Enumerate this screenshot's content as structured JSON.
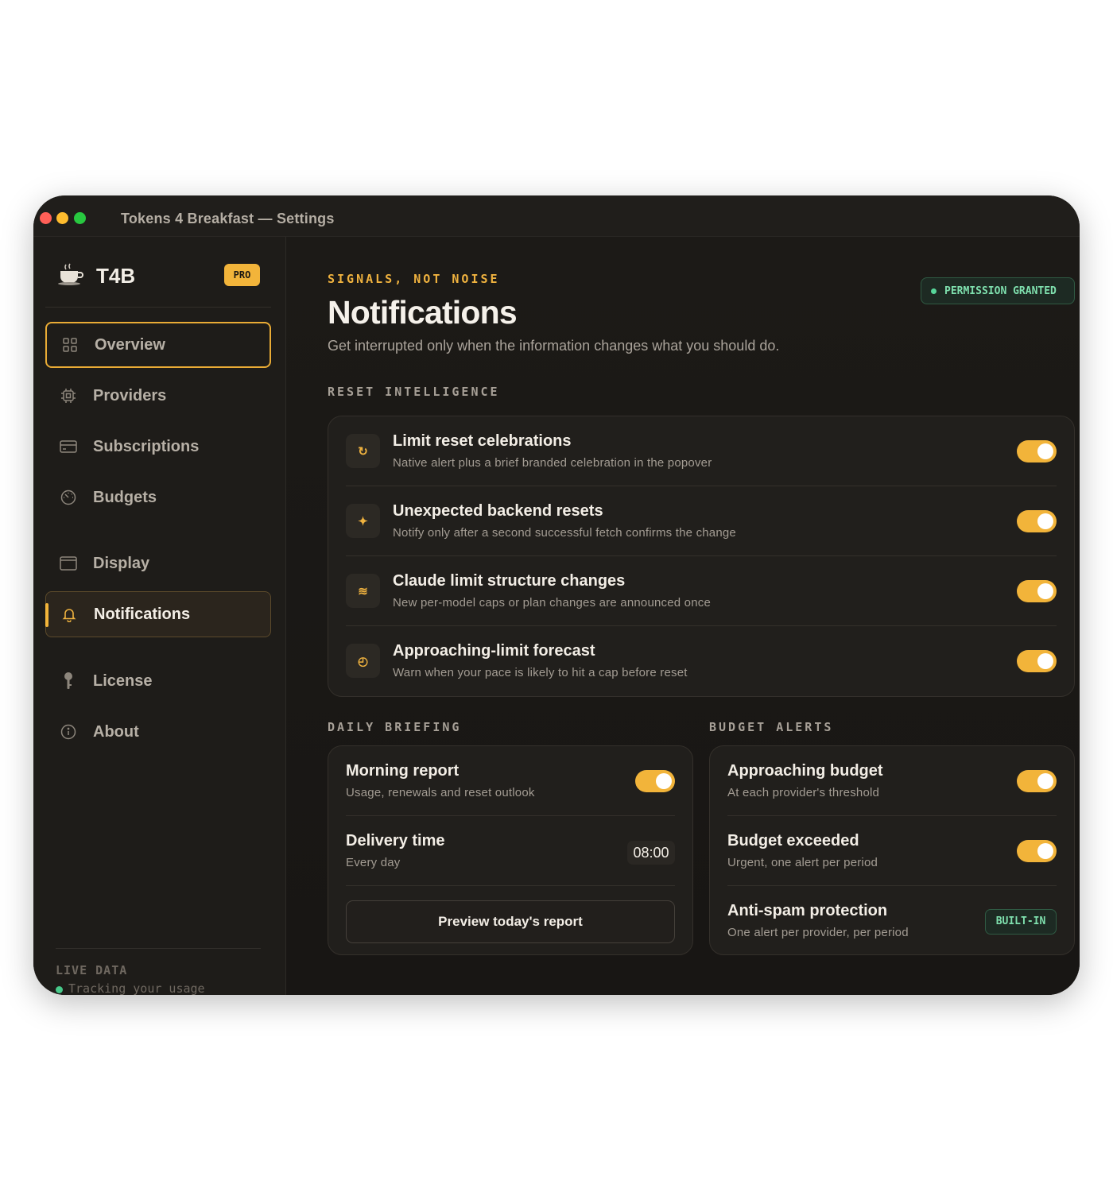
{
  "window": {
    "title": "Tokens 4 Breakfast — Settings"
  },
  "sidebar": {
    "brand": {
      "name": "T4B",
      "badge": "PRO",
      "icon": "coffee-cup-icon"
    },
    "items": [
      {
        "label": "Overview",
        "icon": "grid-icon"
      },
      {
        "label": "Providers",
        "icon": "chip-icon"
      },
      {
        "label": "Subscriptions",
        "icon": "card-icon"
      },
      {
        "label": "Budgets",
        "icon": "gauge-icon"
      },
      {
        "label": "Display",
        "icon": "window-icon"
      },
      {
        "label": "Notifications",
        "icon": "bell-icon"
      },
      {
        "label": "License",
        "icon": "key-icon"
      },
      {
        "label": "About",
        "icon": "info-icon"
      }
    ],
    "live": {
      "label": "LIVE DATA",
      "status": "Tracking your usage",
      "dot_color": "#47c98a"
    }
  },
  "header": {
    "eyebrow": "SIGNALS, NOT NOISE",
    "title": "Notifications",
    "subtitle": "Get interrupted only when the information changes what you should do.",
    "permission_badge": "PERMISSION GRANTED"
  },
  "reset_intelligence": {
    "label": "RESET INTELLIGENCE",
    "rows": [
      {
        "icon": "↻",
        "title": "Limit reset celebrations",
        "desc": "Native alert plus a brief branded celebration in the popover",
        "enabled": true
      },
      {
        "icon": "✦",
        "title": "Unexpected backend resets",
        "desc": "Notify only after a second successful fetch confirms the change",
        "enabled": true
      },
      {
        "icon": "≋",
        "title": "Claude limit structure changes",
        "desc": "New per-model caps or plan changes are announced once",
        "enabled": true
      },
      {
        "icon": "◴",
        "title": "Approaching-limit forecast",
        "desc": "Warn when your pace is likely to hit a cap before reset",
        "enabled": true
      }
    ]
  },
  "daily_briefing": {
    "label": "DAILY BRIEFING",
    "morning": {
      "title": "Morning report",
      "desc": "Usage, renewals and reset outlook",
      "enabled": true
    },
    "delivery": {
      "title": "Delivery time",
      "desc": "Every day",
      "time": "08:00"
    },
    "preview_button": "Preview today's report"
  },
  "budget_alerts": {
    "label": "BUDGET ALERTS",
    "approaching": {
      "title": "Approaching budget",
      "desc": "At each provider's threshold",
      "enabled": true
    },
    "exceeded": {
      "title": "Budget exceeded",
      "desc": "Urgent, one alert per period",
      "enabled": true
    },
    "antispam": {
      "title": "Anti-spam protection",
      "desc": "One alert per provider, per period",
      "badge": "BUILT-IN"
    }
  },
  "colors": {
    "accent": "#f2b43a",
    "success": "#7fe0ae",
    "background": "#1a1816"
  }
}
